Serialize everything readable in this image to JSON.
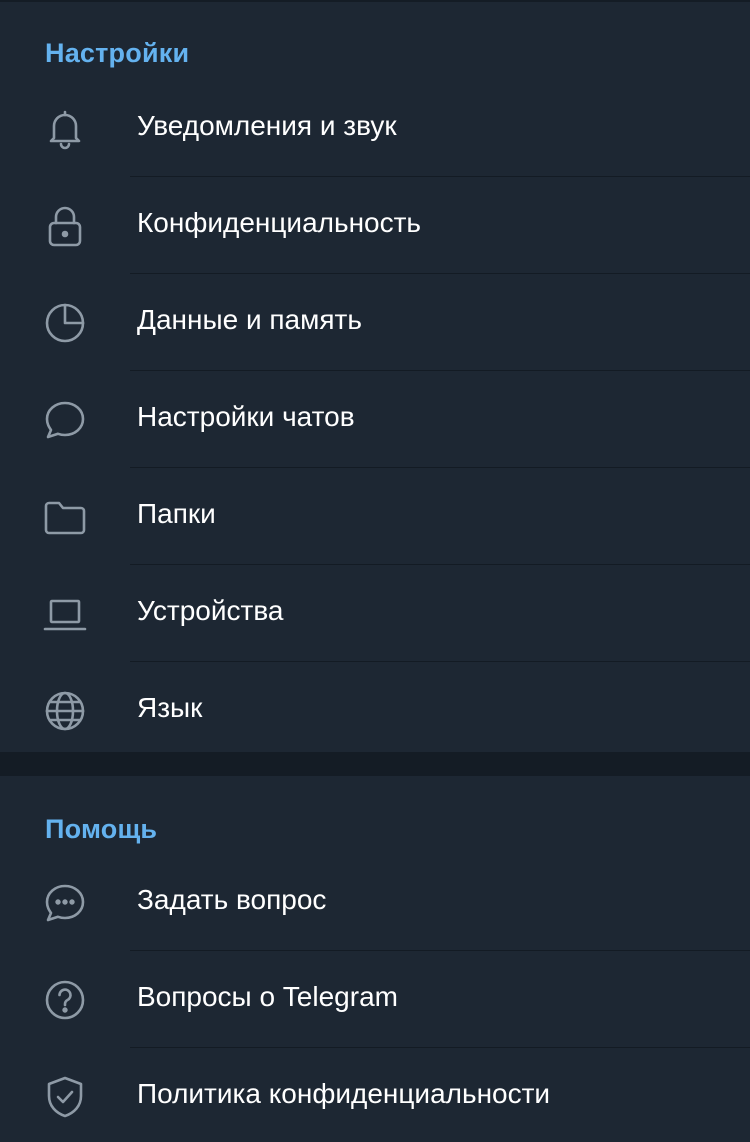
{
  "settings": {
    "title": "Настройки",
    "items": [
      {
        "label": "Уведомления и звук",
        "icon": "bell-icon"
      },
      {
        "label": "Конфиденциальность",
        "icon": "lock-icon"
      },
      {
        "label": "Данные и память",
        "icon": "pie-chart-icon"
      },
      {
        "label": "Настройки чатов",
        "icon": "chat-bubble-icon"
      },
      {
        "label": "Папки",
        "icon": "folder-icon"
      },
      {
        "label": "Устройства",
        "icon": "laptop-icon"
      },
      {
        "label": "Язык",
        "icon": "globe-icon"
      }
    ]
  },
  "help": {
    "title": "Помощь",
    "items": [
      {
        "label": "Задать вопрос",
        "icon": "chat-dots-icon"
      },
      {
        "label": "Вопросы о Telegram",
        "icon": "question-circle-icon"
      },
      {
        "label": "Политика конфиденциальности",
        "icon": "shield-check-icon"
      }
    ]
  },
  "colors": {
    "background": "#1d2733",
    "section_gap": "#141c25",
    "accent": "#64b2ef",
    "icon": "#8e9aa6",
    "text": "#ffffff"
  }
}
